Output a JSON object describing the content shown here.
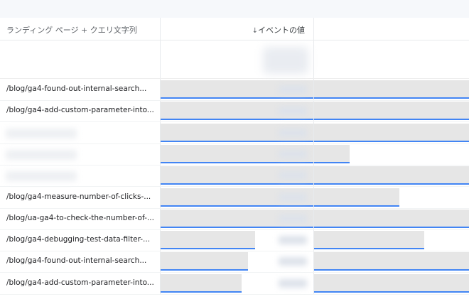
{
  "header": {
    "dimension_label": "ランディング ページ + クエリ文字列",
    "metric_label": "イベントの値",
    "sort_icon": "arrow-down-icon"
  },
  "rows": [
    {
      "label": "/blog/ga4-found-out-internal-search...",
      "bar1": 1.0,
      "bar2": 1.0
    },
    {
      "label": "/blog/ga4-add-custom-parameter-into...",
      "bar1": 1.0,
      "bar2": 1.0
    },
    {
      "label": "",
      "bar1": 1.0,
      "bar2": 1.0
    },
    {
      "label": "",
      "bar1": 1.0,
      "bar2": 0.23
    },
    {
      "label": "",
      "bar1": 1.0,
      "bar2": 1.0
    },
    {
      "label": "/blog/ga4-measure-number-of-clicks-...",
      "bar1": 1.0,
      "bar2": 0.55
    },
    {
      "label": "/blog/ua-ga4-to-check-the-number-of-...",
      "bar1": 1.0,
      "bar2": 1.0
    },
    {
      "label": "/blog/ga4-debugging-test-data-filter-...",
      "bar1": 0.62,
      "bar2": 0.71
    },
    {
      "label": "/blog/ga4-found-out-internal-search...",
      "bar1": 0.57,
      "bar2": 1.0
    },
    {
      "label": "/blog/ga4-add-custom-parameter-into...",
      "bar1": 0.53,
      "bar2": 1.0
    }
  ]
}
